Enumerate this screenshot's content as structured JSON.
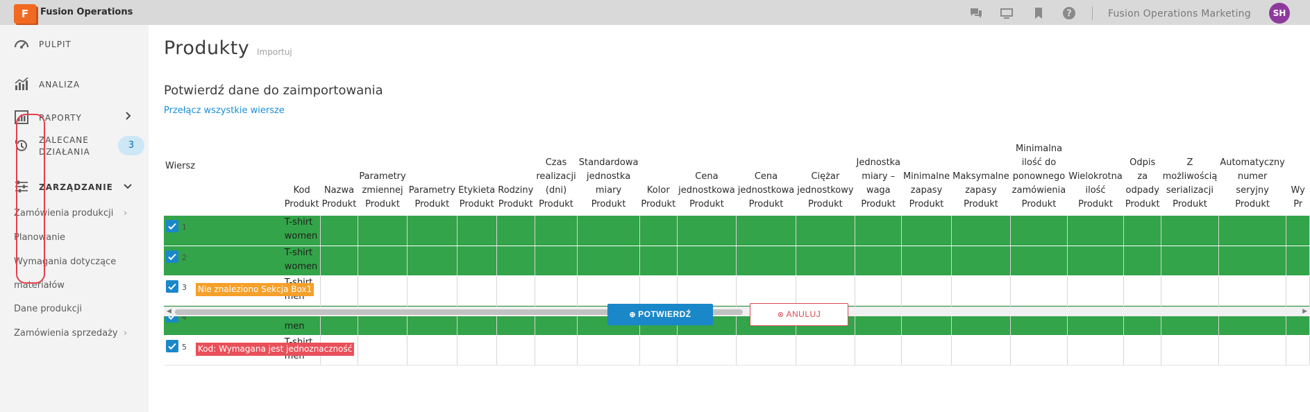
{
  "app": {
    "logo_letter": "F",
    "title": "Fusion Operations",
    "org": "Fusion Operations Marketing",
    "user_initials": "SH"
  },
  "topbar_icons": [
    "chat-icon",
    "monitor-icon",
    "bookmark-icon",
    "help-icon"
  ],
  "sidebar": {
    "items": [
      {
        "label": "PULPIT",
        "icon": "dashboard-icon"
      },
      {
        "label": "ANALIZA",
        "icon": "analytics-icon"
      },
      {
        "label": "RAPORTY",
        "icon": "reports-icon"
      },
      {
        "label_line1": "ZALECANE",
        "label_line2": "DZIAŁANIA",
        "icon": "history-icon",
        "badge": "3"
      },
      {
        "label": "ZARZĄDZANIE",
        "icon": "sliders-icon"
      }
    ],
    "sub_items": [
      {
        "label": "Zamówienia produkcji"
      },
      {
        "label": "Planowanie"
      },
      {
        "label": "Wymagania dotyczące"
      },
      {
        "label": "materiałów"
      },
      {
        "label": "Dane produkcji"
      },
      {
        "label": "Zamówienia sprzedaży"
      }
    ]
  },
  "main": {
    "title": "Produkty",
    "subtitle": "Importuj",
    "section_title": "Potwierdź dane do zaimportowania",
    "toggle_all": "Przełącz wszystkie wiersze",
    "confirm_label": "POTWIERDŹ",
    "cancel_label": "ANULUJ"
  },
  "table": {
    "columns": [
      {
        "label": "Wiersz"
      },
      {
        "label": "Kod Produkt"
      },
      {
        "label": "Nazwa Produkt"
      },
      {
        "label": "Parametry zmiennej Produkt"
      },
      {
        "label": "Parametry Produkt"
      },
      {
        "label": "Etykieta Produkt"
      },
      {
        "label": "Rodziny Produkt"
      },
      {
        "label": "Czas realizacji (dni) Produkt"
      },
      {
        "label": "Standardowa jednostka miary Produkt"
      },
      {
        "label": "Kolor Produkt"
      },
      {
        "label": "Cena jednostkowa Produkt"
      },
      {
        "label": "Cena jednostkowa Produkt"
      },
      {
        "label": "Ciężar jednostkowy Produkt"
      },
      {
        "label": "Jednostka miary – waga Produkt"
      },
      {
        "label": "Minimalne zapasy Produkt"
      },
      {
        "label": "Maksymalne zapasy Produkt"
      },
      {
        "label": "Minimalna ilość do ponownego zamówienia Produkt"
      },
      {
        "label": "Wielokrotna ilość Produkt"
      },
      {
        "label": "Odpis za odpady Produkt"
      },
      {
        "label": "Z możliwością serializacji Produkt"
      },
      {
        "label": "Automatyczny numer seryjny Produkt"
      },
      {
        "label": "Wy Pr"
      }
    ],
    "rows": [
      {
        "num": "1",
        "checked": true,
        "status": "ok",
        "error": "",
        "code_line1": "T-shirt",
        "code_line2": "women"
      },
      {
        "num": "2",
        "checked": true,
        "status": "ok",
        "error": "",
        "code_line1": "T-shirt",
        "code_line2": "women"
      },
      {
        "num": "3",
        "checked": true,
        "status": "warning",
        "error": "Nie znaleziono Sekcja Box1",
        "code_line1": "T-shirt",
        "code_line2": "men"
      },
      {
        "num": "4",
        "checked": true,
        "status": "ok",
        "error": "",
        "code_line1": "T-shirt",
        "code_line2": "men"
      },
      {
        "num": "5",
        "checked": true,
        "status": "error",
        "error": "Kod: Wymagana jest jednoznaczność",
        "code_line1": "T-shirt",
        "code_line2": "men"
      }
    ]
  },
  "colors": {
    "accent": "#1a87c9",
    "row_ok": "#33a449",
    "warning": "#f5a02a",
    "error": "#e9505a",
    "logo": "#f26a21",
    "avatar": "#8e3a9d"
  }
}
